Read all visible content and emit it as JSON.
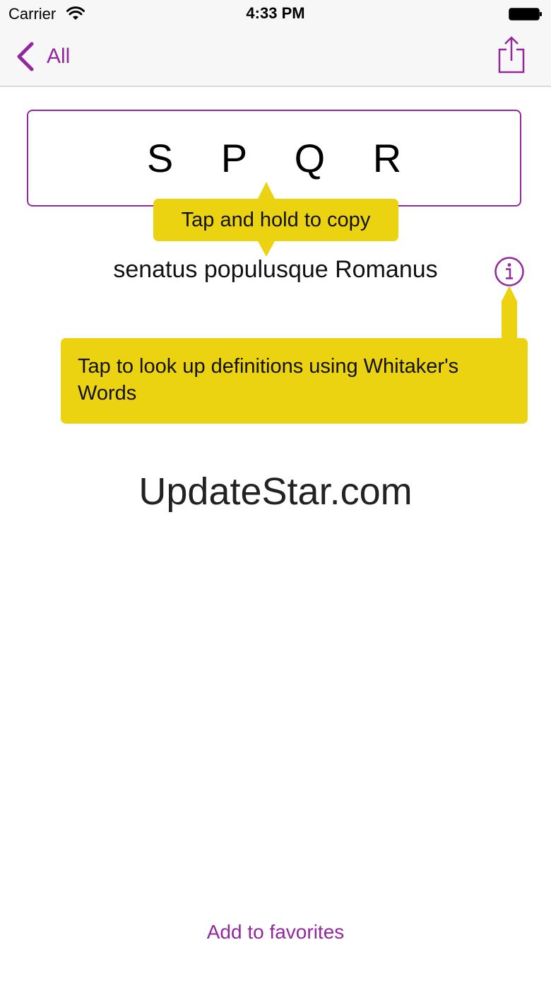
{
  "status_bar": {
    "carrier": "Carrier",
    "time": "4:33 PM"
  },
  "nav": {
    "back_label": "All",
    "back_icon": "chevron-left-icon",
    "share_icon": "share-icon"
  },
  "entry": {
    "abbreviation": "S P Q R",
    "expansion": "senatus populusque Romanus",
    "info_icon": "info-icon"
  },
  "tips": {
    "copy": "Tap and hold to copy",
    "lookup": "Tap to look up definitions using Whitaker's Words"
  },
  "watermark": "UpdateStar.com",
  "footer": {
    "favorites_label": "Add to favorites"
  },
  "colors": {
    "accent": "#93279e",
    "tooltip": "#ecd312",
    "bar_background": "#f7f7f7"
  }
}
